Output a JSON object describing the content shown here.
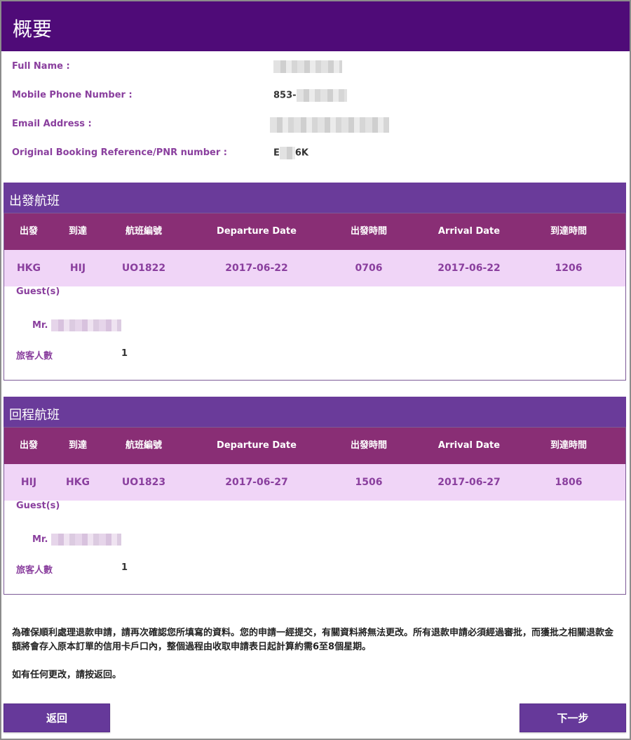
{
  "header": {
    "title": "概要"
  },
  "info": {
    "full_name_label": "Full Name :",
    "mobile_label": "Mobile Phone Number :",
    "mobile_prefix": "853-",
    "email_label": "Email Address :",
    "pnr_label": "Original Booking Reference/PNR number :",
    "pnr_start": "E",
    "pnr_end": "6K"
  },
  "columns": [
    "出發",
    "到達",
    "航班編號",
    "Departure Date",
    "出發時間",
    "Arrival Date",
    "到達時間"
  ],
  "outbound": {
    "title": "出發航班",
    "row": [
      "HKG",
      "HIJ",
      "UO1822",
      "2017-06-22",
      "0706",
      "2017-06-22",
      "1206"
    ],
    "guests_label": "Guest(s)",
    "guest_title": "Mr.",
    "count_label": "旅客人數",
    "count": "1"
  },
  "inbound": {
    "title": "回程航班",
    "row": [
      "HIJ",
      "HKG",
      "UO1823",
      "2017-06-27",
      "1506",
      "2017-06-27",
      "1806"
    ],
    "guests_label": "Guest(s)",
    "guest_title": "Mr.",
    "count_label": "旅客人數",
    "count": "1"
  },
  "notice": "為確保順利處理退款申請，請再次確認您所填寫的資料。您的申請一經提交，有關資料將無法更改。所有退款申請必須經過審批，而獲批之相關退款金額將會存入原本訂單的信用卡戶口內，整個過程由收取申請表日起計算約需6至8個星期。",
  "notice2": "如有任何更改，請按返回。",
  "buttons": {
    "back": "返回",
    "next": "下一步"
  },
  "colors": {
    "header": "#4f0b78",
    "section": "#6a3b9a",
    "table_head": "#892e75",
    "row_bg": "#f0d5f7",
    "label": "#8a3f9e"
  }
}
